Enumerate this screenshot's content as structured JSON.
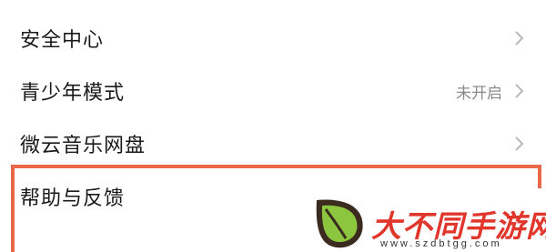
{
  "settings_list": {
    "items": [
      {
        "label": "安全中心",
        "value": ""
      },
      {
        "label": "青少年模式",
        "value": "未开启"
      },
      {
        "label": "微云音乐网盘",
        "value": ""
      },
      {
        "label": "帮助与反馈",
        "value": ""
      }
    ]
  },
  "partial_below": "",
  "watermark": {
    "title": "大不同手游网",
    "url": "www.szdbtgg.com"
  },
  "colors": {
    "highlight": "#e8694a",
    "text": "#1a1a1a",
    "value": "#8a8a8a",
    "chevron": "#b8b8b8",
    "watermark_red": "#e0362c",
    "logo_dark": "#3b2a1e",
    "logo_green": "#8cc63e"
  }
}
